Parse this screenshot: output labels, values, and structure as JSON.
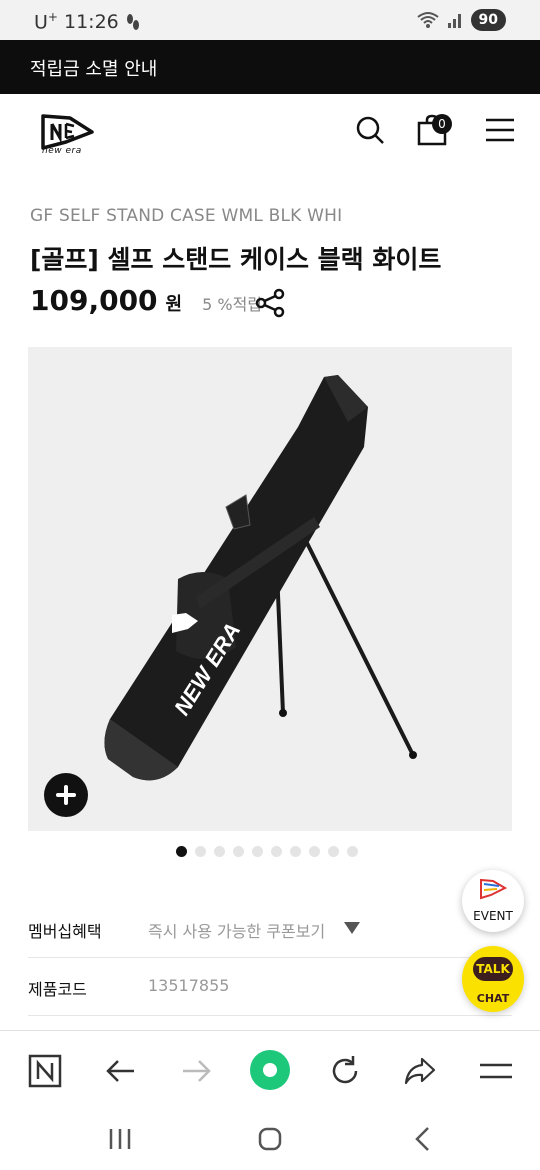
{
  "status_bar": {
    "carrier": "U",
    "carrier_sup": "+",
    "time": "11:26",
    "battery": "90"
  },
  "banner": {
    "text": "적립금 소멸 안내"
  },
  "header": {
    "logo_text": "NEW ERA",
    "cart_count": "0"
  },
  "product": {
    "code_en": "GF SELF STAND CASE WML BLK WHI",
    "title": "[골프] 셀프 스탠드 케이스 블랙 화이트",
    "price": "109,000",
    "price_unit": "원",
    "points": "5 %적립",
    "image_dots": 10,
    "image_active_dot": 0
  },
  "info_rows": {
    "membership_label": "멤버십혜택",
    "membership_value": "즉시 사용 가능한 쿠폰보기",
    "code_label": "제품코드",
    "code_value": "13517855"
  },
  "floating": {
    "event_label": "EVENT",
    "talk_label": "TALK",
    "chat_label": "CHAT"
  },
  "colors": {
    "banner_bg": "#0d0d0d",
    "accent_green": "#1ec800",
    "kakao_yellow": "#fae100"
  }
}
